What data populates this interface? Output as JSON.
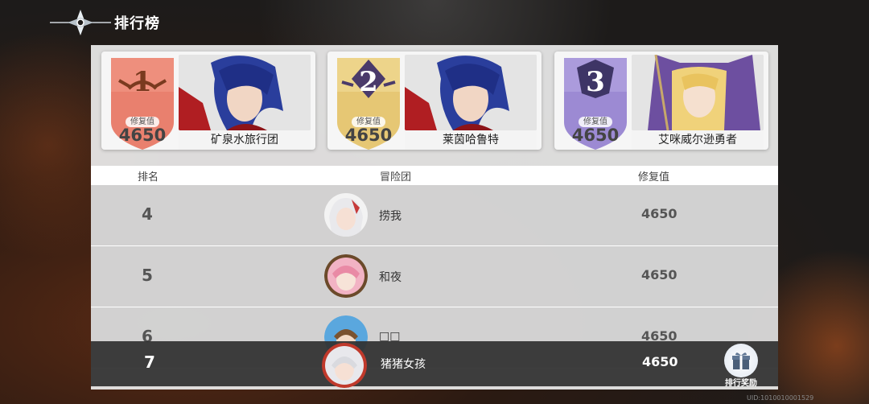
{
  "header": {
    "title": "排行榜"
  },
  "top3": [
    {
      "rank": "1",
      "score_label": "修复值",
      "score": "4650",
      "name": "矿泉水旅行团",
      "color": "#e9806e"
    },
    {
      "rank": "2",
      "score_label": "修复值",
      "score": "4650",
      "name": "莱茵哈鲁特",
      "color": "#e6c774"
    },
    {
      "rank": "3",
      "score_label": "修复值",
      "score": "4650",
      "name": "艾咪威尔逊勇者",
      "color": "#9c8ad3"
    }
  ],
  "table": {
    "col_rank": "排名",
    "col_team": "冒险团",
    "col_score": "修复值",
    "rows": [
      {
        "rank": "4",
        "name": "捞我",
        "score": "4650"
      },
      {
        "rank": "5",
        "name": "和夜",
        "score": "4650"
      },
      {
        "rank": "6",
        "name": "□□",
        "score": "4650"
      }
    ]
  },
  "self": {
    "rank": "7",
    "name": "猪猪女孩",
    "score": "4650"
  },
  "reward_button": {
    "label": "排行奖励"
  },
  "uid": "UID:1010010001529"
}
